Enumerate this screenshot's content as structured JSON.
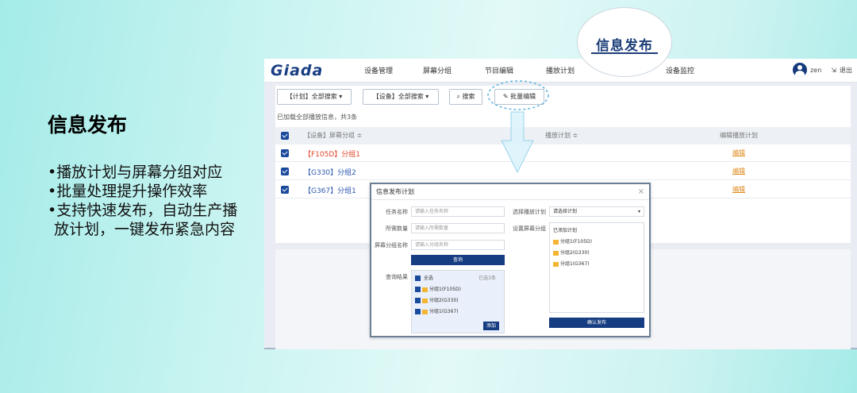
{
  "slide": {
    "title": "信息发布",
    "bullets": [
      "•播放计划与屏幕分组对应",
      "•批量处理提升操作效率",
      "•支持快速发布，自动生产播放计划，一键发布紧急内容"
    ]
  },
  "callout": {
    "label": "信息发布"
  },
  "app": {
    "logo": "Giada",
    "nav": [
      "设备管理",
      "屏幕分组",
      "节目编辑",
      "播放计划",
      "信息发布",
      "设备监控"
    ],
    "user": {
      "name": "zen",
      "logout": "退出"
    },
    "toolbar": {
      "plan_filter": "【计划】全部搜索 ▾",
      "device_filter": "【设备】全部搜索 ▾",
      "search_label": "搜索",
      "batch_edit_label": "批量编辑"
    },
    "loaded_text": "已加载全部播放信息，共3条",
    "table": {
      "headers": [
        "【设备】屏幕分组 ≑",
        "播放计划 ≑",
        "编辑播放计划"
      ],
      "rows": [
        {
          "group": "【F105D】分组1",
          "action": "编辑",
          "highlight": true
        },
        {
          "group": "【G330】分组2",
          "action": "编辑",
          "highlight": false
        },
        {
          "group": "【G367】分组1",
          "action": "编辑",
          "highlight": false
        }
      ]
    }
  },
  "dialog": {
    "title": "信息发布计划",
    "close": "×",
    "fields": [
      {
        "label": "任务名称",
        "placeholder": "请输入任务名称"
      },
      {
        "label": "所需数量",
        "placeholder": "请输入所需数量"
      },
      {
        "label": "屏幕分组名称",
        "placeholder": "请输入分组名称"
      }
    ],
    "query_button": "查询",
    "query_result_label": "查询结果",
    "result_header": {
      "all": "全选",
      "count": "已选3条"
    },
    "result_items": [
      "分组1(F105D)",
      "分组2(G330)",
      "分组1(G367)"
    ],
    "add_button": "添加",
    "plan_select": {
      "label": "选择播放计划",
      "value": "请选择计划"
    },
    "selected_label": "设置屏幕分组",
    "selected_title": "已添加计划",
    "selected_items": [
      "分组1(F105D)",
      "分组2(G330)",
      "分组1(G367)"
    ],
    "confirm_button": "确认发布"
  },
  "colors": {
    "brand": "#163c81",
    "accent_orange": "#e08a1c",
    "highlight_red": "#e0452c",
    "group_blue": "#2c58b0"
  }
}
